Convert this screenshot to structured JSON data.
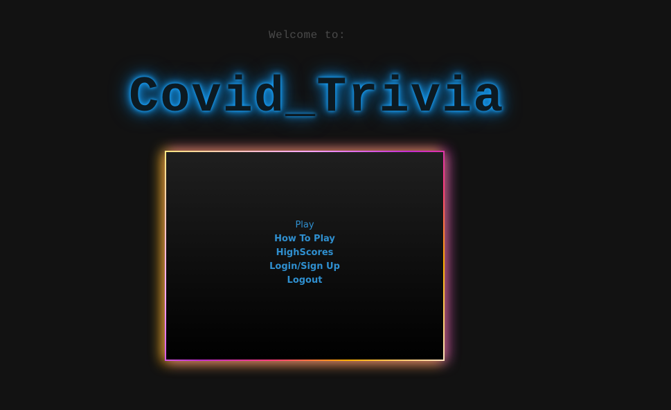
{
  "header": {
    "welcome_text": "Welcome to:",
    "title": "Covid_Trivia"
  },
  "menu": {
    "items": [
      {
        "label": "Play"
      },
      {
        "label": "How To Play"
      },
      {
        "label": "HighScores"
      },
      {
        "label": "Login/Sign Up"
      },
      {
        "label": "Logout"
      }
    ]
  },
  "colors": {
    "background": "#121212",
    "title_glow": "#1a9bf0",
    "menu_link": "#2f8fcf"
  }
}
